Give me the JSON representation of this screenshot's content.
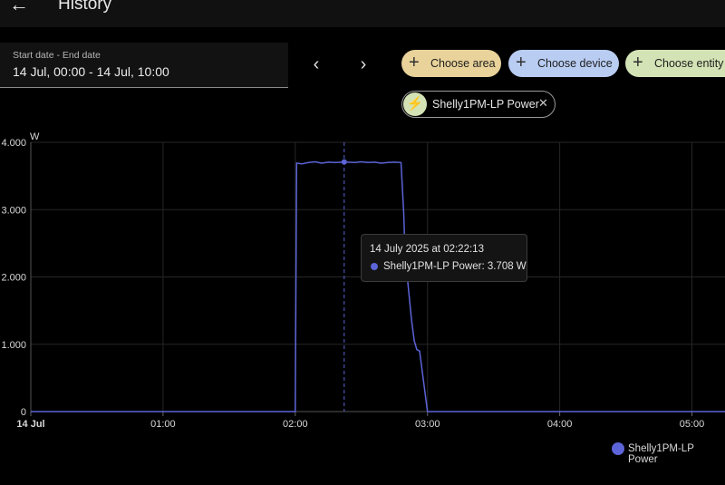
{
  "header": {
    "back_icon": "arrow-left-icon",
    "title": "History"
  },
  "date_range": {
    "label": "Start date - End date",
    "value": "14 Jul, 00:00 - 14 Jul, 10:00"
  },
  "nav": {
    "prev_icon": "chevron-left-icon",
    "next_icon": "chevron-right-icon",
    "prev_glyph": "‹",
    "next_glyph": "›"
  },
  "target_chips": [
    {
      "label": "Choose area",
      "color": "#e9d39a"
    },
    {
      "label": "Choose device",
      "color": "#b9cdf3"
    },
    {
      "label": "Choose entity",
      "color": "#d4e3b5"
    }
  ],
  "selected_entity": {
    "label": "Shelly1PM-LP Power",
    "icon": "lightning-bolt-icon"
  },
  "tooltip": {
    "time": "14 July 2025 at 02:22:13",
    "value": "Shelly1PM-LP Power: 3.708 W"
  },
  "legend": {
    "label": "Shelly1PM-LP Power"
  },
  "colors": {
    "series": "#5c64d7"
  },
  "chart_data": {
    "type": "line",
    "ylabel": "W",
    "ylim": [
      0,
      4000
    ],
    "y_ticks": [
      "0",
      "1.000",
      "2.000",
      "3.000",
      "4.000"
    ],
    "x_ticks": [
      "14 Jul",
      "01:00",
      "02:00",
      "03:00",
      "04:00",
      "05:00"
    ],
    "xlim_hours": [
      0,
      5.25
    ],
    "cursor_hour": 2.37,
    "series": [
      {
        "name": "Shelly1PM-LP Power",
        "x_hours": [
          0,
          2.0,
          2.01,
          2.05,
          2.1,
          2.15,
          2.2,
          2.25,
          2.3,
          2.37,
          2.45,
          2.5,
          2.55,
          2.6,
          2.65,
          2.7,
          2.75,
          2.8,
          2.82,
          2.83,
          2.85,
          2.87,
          2.88,
          2.9,
          2.92,
          2.94,
          2.96,
          2.98,
          3.0,
          3.01,
          5.25
        ],
        "values": [
          0,
          0,
          3690,
          3680,
          3700,
          3710,
          3690,
          3705,
          3700,
          3708,
          3700,
          3710,
          3700,
          3705,
          3690,
          3700,
          3705,
          3700,
          2950,
          2350,
          1950,
          1550,
          1350,
          1050,
          920,
          900,
          600,
          300,
          0,
          0,
          0
        ]
      }
    ]
  }
}
